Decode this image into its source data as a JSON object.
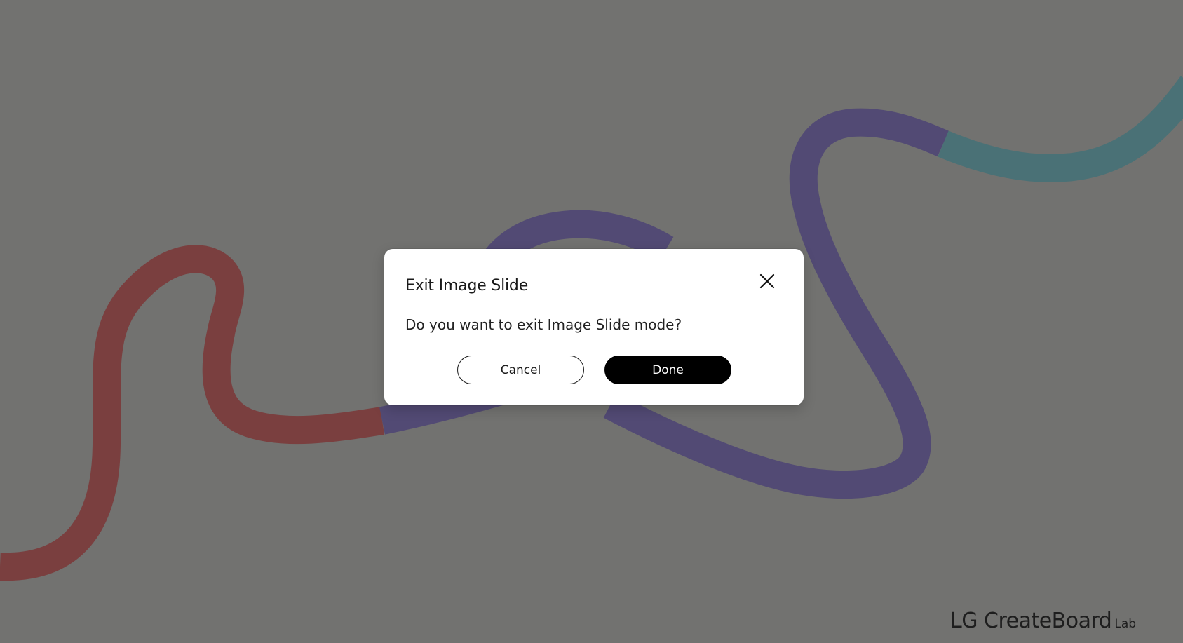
{
  "background": {
    "color": "#727270",
    "ribbon_colors": {
      "red": "#7a3f3f",
      "purple": "#524a74",
      "teal": "#4a7176"
    }
  },
  "dialog": {
    "title": "Exit Image Slide",
    "message": "Do you want to exit Image Slide mode?",
    "close_icon": "close-icon",
    "buttons": {
      "cancel_label": "Cancel",
      "done_label": "Done"
    }
  },
  "brand": {
    "logo_text": "LG CreateBoard",
    "logo_suffix": "Lab"
  }
}
